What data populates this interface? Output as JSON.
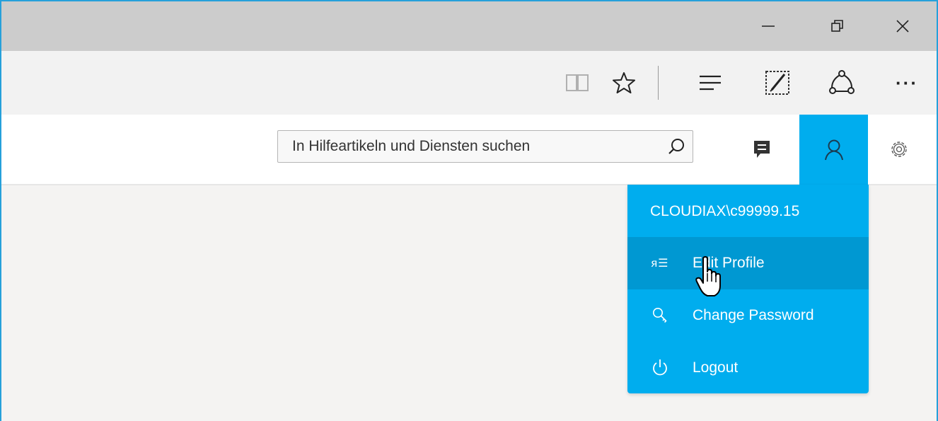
{
  "window": {
    "minimize_icon": "minimize-icon",
    "restore_icon": "restore-icon",
    "close_icon": "close-icon"
  },
  "browser_toolbar": {
    "icons": [
      "reading-view-icon",
      "favorites-star-icon",
      "hub-icon",
      "web-note-icon",
      "share-icon",
      "more-icon"
    ],
    "more_label": "···"
  },
  "header": {
    "search": {
      "placeholder": "In Hilfeartikeln und Diensten suchen"
    },
    "feedback_icon": "feedback-icon",
    "user_icon": "user-icon",
    "settings_icon": "gear-icon"
  },
  "user_menu": {
    "username": "CLOUDIAX\\c99999.15",
    "items": [
      {
        "label": "Edit Profile",
        "icon": "profile-icon",
        "icon_glyph": "ᴙ☰",
        "active": true
      },
      {
        "label": "Change Password",
        "icon": "key-icon",
        "active": false
      },
      {
        "label": "Logout",
        "icon": "power-icon",
        "active": false
      }
    ]
  },
  "colors": {
    "accent": "#00adee",
    "accent_hover": "#0098d2",
    "titlebar": "#cccccc",
    "toolbar": "#f2f2f2",
    "content_bg": "#f4f3f2",
    "window_border": "#26a0da"
  }
}
